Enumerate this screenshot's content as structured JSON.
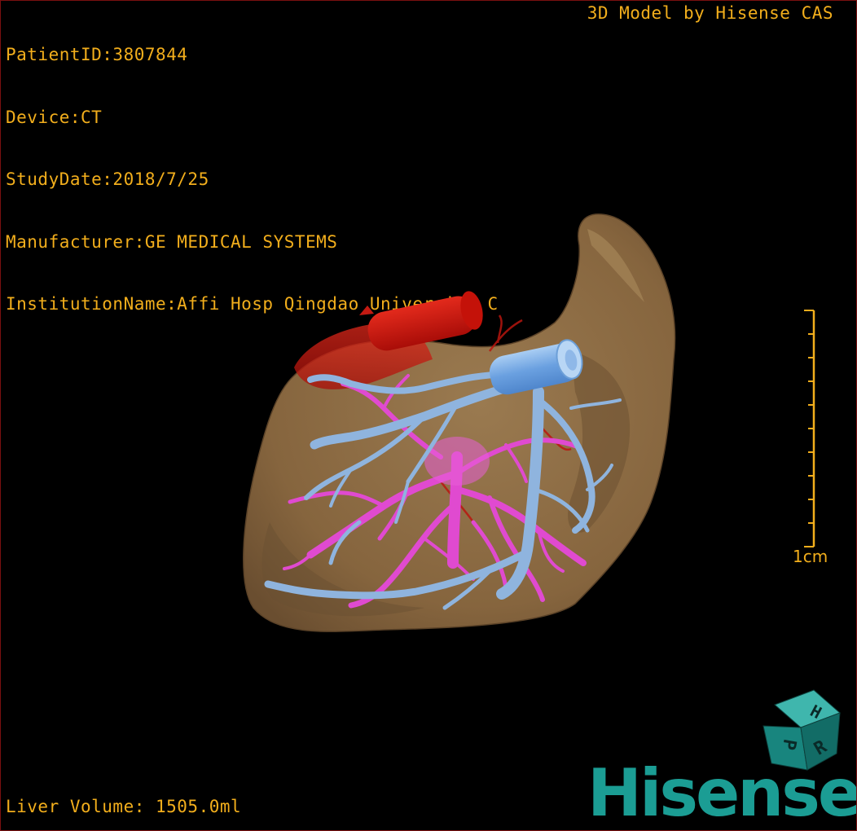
{
  "dicom_info": {
    "patient_id": "PatientID:3807844",
    "device": "Device:CT",
    "study_date": "StudyDate:2018/7/25",
    "manufacturer": "Manufacturer:GE MEDICAL SYSTEMS",
    "institution": "InstitutionName:Affi Hosp Qingdao University C"
  },
  "watermark": "3D Model by Hisense CAS",
  "liver_volume": "Liver Volume: 1505.0ml",
  "scale": {
    "label": "1cm",
    "ticks": 11
  },
  "orientation_cube": {
    "face_top": "H",
    "face_front": "P",
    "face_side": "R"
  },
  "brand": "Hisense",
  "colors": {
    "overlay_text": "#f2ae1c",
    "liver": "#8a6a42",
    "artery": "#d1160f",
    "portal_vein": "#e04ad0",
    "hepatic_vein": "#8fb4de",
    "brand": "#1b9d94"
  }
}
